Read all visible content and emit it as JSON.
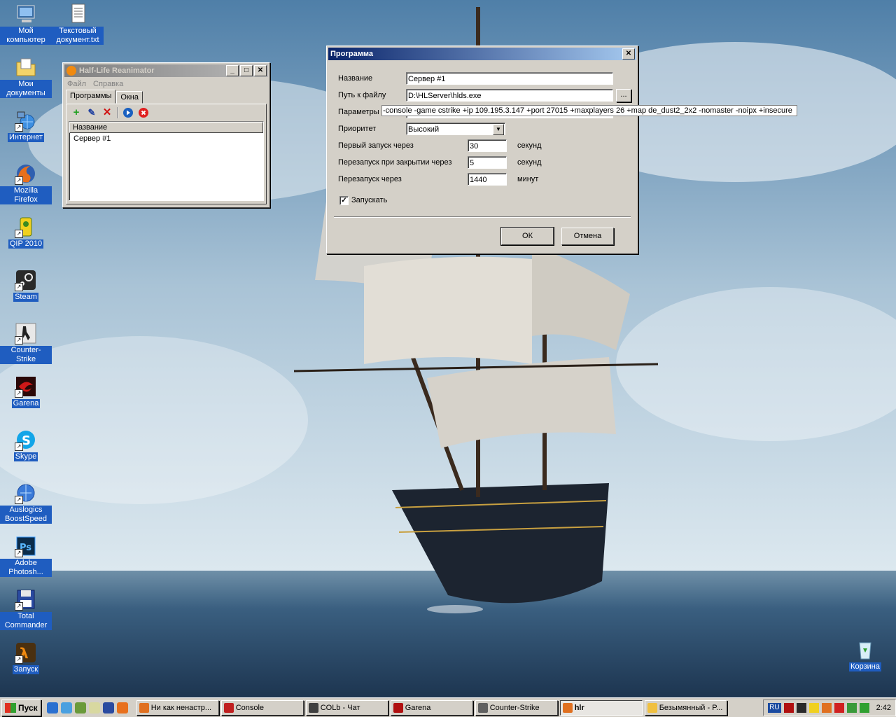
{
  "desktop": {
    "icons": [
      {
        "label": "Мой компьютер"
      },
      {
        "label": "Текстовый документ.txt"
      },
      {
        "label": "Мои документы"
      },
      {
        "label": "Интернет"
      },
      {
        "label": "Mozilla Firefox"
      },
      {
        "label": "QIP 2010"
      },
      {
        "label": "Steam"
      },
      {
        "label": "Counter-Strike"
      },
      {
        "label": "Garena"
      },
      {
        "label": "Skype"
      },
      {
        "label": "Auslogics BoostSpeed"
      },
      {
        "label": "Adobe Photosh..."
      },
      {
        "label": "Total Commander"
      },
      {
        "label": "Запуск"
      },
      {
        "label": "Корзина"
      }
    ]
  },
  "hlr": {
    "title": "Half-Life Reanimator",
    "menu": [
      "Файл",
      "Справка"
    ],
    "tabs": [
      "Программы",
      "Окна"
    ],
    "column": "Название",
    "rows": [
      "Сервер #1"
    ],
    "tool_icons": [
      "add-icon",
      "edit-icon",
      "delete-icon",
      "start-icon",
      "stop-icon"
    ]
  },
  "dialog": {
    "title": "Программа",
    "name_label": "Название",
    "name_value": "Сервер #1",
    "path_label": "Путь к файлу",
    "path_value": "D:\\HLServer\\hlds.exe",
    "browse_label": "...",
    "params_label": "Параметры",
    "params_value": "-console -game cstrike +ip 109.195.3.147 +port 27015 +maxplayers 26 +map de_dust2_2x2 -nomaster -noipx +insecure",
    "priority_label": "Приоритет",
    "priority_value": "Высокий",
    "first_run_label": "Первый запуск через",
    "first_run_value": "30",
    "first_run_unit": "секунд",
    "restart_close_label": "Перезапуск при закрытии через",
    "restart_close_value": "5",
    "restart_close_unit": "секунд",
    "restart_label": "Перезапуск через",
    "restart_value": "1440",
    "restart_unit": "минут",
    "run_label": "Запускать",
    "run_checked": true,
    "ok_label": "ОК",
    "cancel_label": "Отмена"
  },
  "taskbar": {
    "start_label": "Пуск",
    "tasks": [
      {
        "label": "Ни как ненастр...",
        "color": "#e07020"
      },
      {
        "label": "Console",
        "color": "#c02020"
      },
      {
        "label": "COLb - Чат",
        "color": "#404040"
      },
      {
        "label": "Garena",
        "color": "#b01010"
      },
      {
        "label": "Counter-Strike",
        "color": "#606060"
      },
      {
        "label": "hlr",
        "color": "#e07020"
      },
      {
        "label": "Безымянный - P...",
        "color": "#f0c040"
      }
    ],
    "lang": "RU",
    "clock": "2:42"
  }
}
